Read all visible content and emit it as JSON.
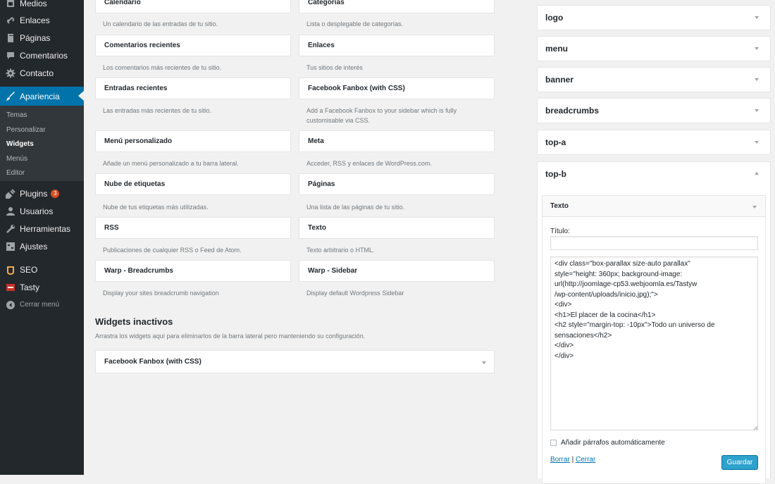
{
  "sidebar": {
    "menu": [
      {
        "label": "Medios",
        "icon": "media-icon"
      },
      {
        "label": "Enlaces",
        "icon": "links-icon"
      },
      {
        "label": "Páginas",
        "icon": "pages-icon"
      },
      {
        "label": "Comentarios",
        "icon": "comments-icon"
      },
      {
        "label": "Contacto",
        "icon": "gear-icon"
      },
      {
        "label": "Apariencia",
        "icon": "appearance-brush-icon"
      }
    ],
    "submenu": [
      "Temas",
      "Personalizar",
      "Widgets",
      "Menús",
      "Editor"
    ],
    "menu2": [
      {
        "label": "Plugins",
        "icon": "plugins-icon",
        "badge": "3"
      },
      {
        "label": "Usuarios",
        "icon": "users-icon"
      },
      {
        "label": "Herramientas",
        "icon": "tools-icon"
      },
      {
        "label": "Ajustes",
        "icon": "settings-icon"
      },
      {
        "label": "SEO",
        "icon": "seo-icon"
      },
      {
        "label": "Tasty",
        "icon": "tasty-icon"
      },
      {
        "label": "Cerrar menú",
        "icon": "collapse-icon"
      }
    ]
  },
  "available_widgets": [
    {
      "name": "Calendario",
      "desc": "Un calendario de las entradas de tu sitio."
    },
    {
      "name": "Categorías",
      "desc": "Lista o desplegable de categorías."
    },
    {
      "name": "Comentarios recientes",
      "desc": "Los comentarios más recientes de tu sitio."
    },
    {
      "name": "Enlaces",
      "desc": "Tus sitios de interés"
    },
    {
      "name": "Entradas recientes",
      "desc": "Las entradas más recientes de tu sitio."
    },
    {
      "name": "Facebook Fanbox (with CSS)",
      "desc": "Add a Facebook Fanbox to your sidebar which is fully customisable via CSS."
    },
    {
      "name": "Menú personalizado",
      "desc": "Añade un menú personalizado a tu barra lateral."
    },
    {
      "name": "Meta",
      "desc": "Acceder, RSS y enlaces de WordPress.com."
    },
    {
      "name": "Nube de etiquetas",
      "desc": "Nube de tus etiquetas más utilizadas."
    },
    {
      "name": "Páginas",
      "desc": "Una lista de las páginas de tu sitio."
    },
    {
      "name": "RSS",
      "desc": "Publicaciones de cualquier RSS o Feed de Atom."
    },
    {
      "name": "Texto",
      "desc": "Texto arbitrario o HTML."
    },
    {
      "name": "Warp - Breadcrumbs",
      "desc": "Display your sites breadcrumb navigation"
    },
    {
      "name": "Warp - Sidebar",
      "desc": "Display default Wordpress Sidebar"
    }
  ],
  "inactive": {
    "title": "Widgets inactivos",
    "desc": "Arrastra los widgets aquí para eliminarlos de la barra lateral pero manteniendo su configuración.",
    "widget": "Facebook Fanbox (with CSS)"
  },
  "sidebars": [
    "logo",
    "menu",
    "banner",
    "breadcrumbs",
    "top-a"
  ],
  "topb": {
    "title": "top-b",
    "widget_title": "Texto",
    "titulo_label": "Título:",
    "titulo_value": "",
    "content": "<div class=\"box-parallax size-auto parallax\"\nstyle=\"height: 360px; background-image:\nurl(http://joomlage-cp53.webjoomla.es/Tastyw\n/wp-content/uploads/inicio.jpg);\">\n<div>\n<h1>El placer de la cocina</h1>\n<h2 style=\"margin-top: -10px\">Todo un universo de\nsensaciones</h2>\n</div>\n</div>",
    "autop_label": "Añadir párrafos automáticamente",
    "delete_label": "Borrar",
    "separator": "|",
    "close_label": "Cerrar",
    "save_label": "Guardar"
  },
  "colors": {
    "sidebar_bg": "#23282d",
    "accent": "#0073aa",
    "button": "#2ea2cc",
    "badge": "#d54e21"
  }
}
